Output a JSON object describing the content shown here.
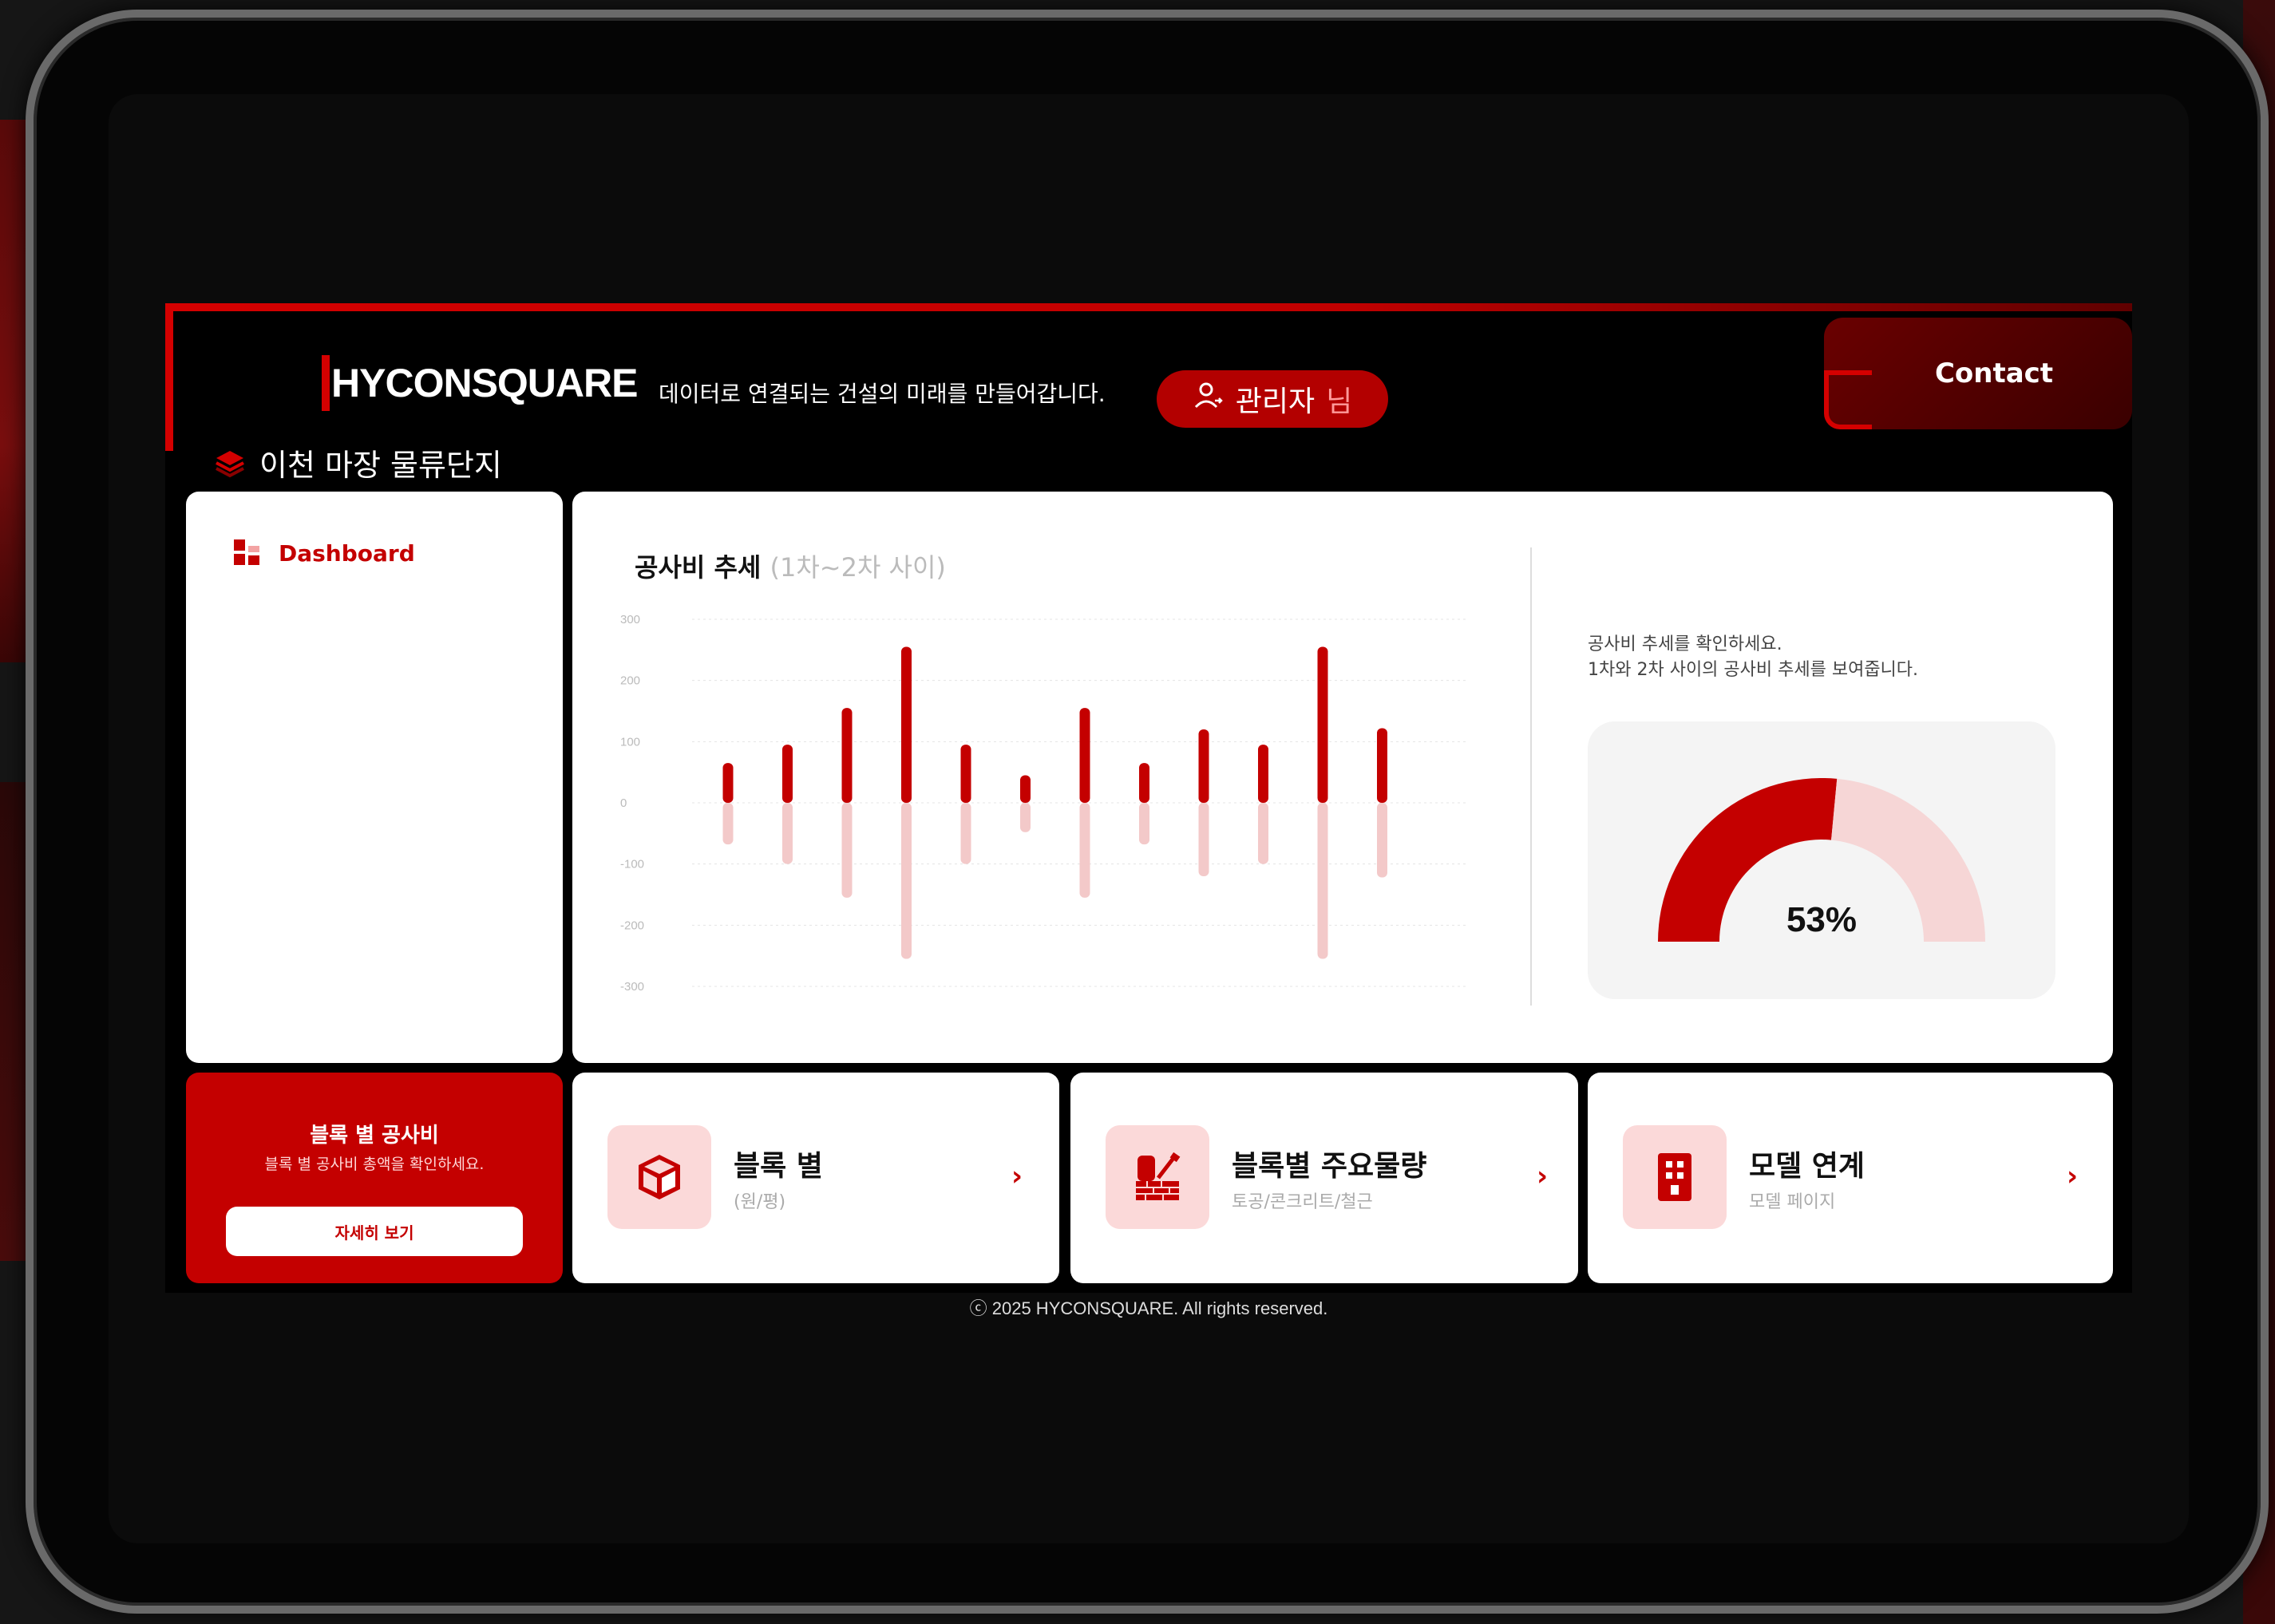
{
  "header": {
    "logo_text": "HYCONSQUARE",
    "tagline": "데이터로 연결되는 건설의 미래를 만들어갑니다.",
    "user_name": "관리자",
    "user_suffix": "님",
    "contact_label": "Contact"
  },
  "project": {
    "title": "이천 마장 물류단지"
  },
  "sidebar": {
    "items": [
      {
        "label": "Dashboard",
        "icon": "dashboard-icon"
      }
    ]
  },
  "chart_panel": {
    "title": "공사비 추세",
    "subtitle": "(1차~2차 사이)",
    "description_line1": "공사비 추세를 확인하세요.",
    "description_line2": "1차와 2차 사이의 공사비 추세를 보여줍니다.",
    "gauge_value": 53,
    "gauge_label": "53%"
  },
  "chart_data": {
    "type": "bar",
    "y_ticks": [
      "300",
      "200",
      "100",
      "0",
      "-100",
      "-200",
      "-300"
    ],
    "ylim": [
      -300,
      300
    ],
    "grid": true,
    "series": [
      {
        "values": [
          65,
          95,
          155,
          255,
          95,
          45,
          155,
          65,
          120,
          95,
          255,
          122
        ]
      },
      {
        "values": [
          -68,
          -100,
          -155,
          -255,
          -100,
          -48,
          -155,
          -68,
          -120,
          -100,
          -255,
          -122
        ]
      }
    ],
    "colors": {
      "positive": "#c40000",
      "negative": "#f3c9c9"
    }
  },
  "promo": {
    "title": "블록 별 공사비",
    "subtitle": "블록 별 공사비 총액을 확인하세요.",
    "button_label": "자세히 보기"
  },
  "cards": [
    {
      "title": "블록 별",
      "sub": "(원/평)",
      "icon": "cube-icon"
    },
    {
      "title": "블록별 주요물량",
      "sub": "토공/콘크리트/철근",
      "icon": "construction-materials-icon"
    },
    {
      "title": "모델 연계",
      "sub": "모델 페이지",
      "icon": "building-icon"
    }
  ],
  "footer": {
    "copyright": "ⓒ 2025 HYCONSQUARE. All rights reserved."
  },
  "theme": {
    "accent": "#c40000",
    "accent_light": "#fbd9d9"
  }
}
